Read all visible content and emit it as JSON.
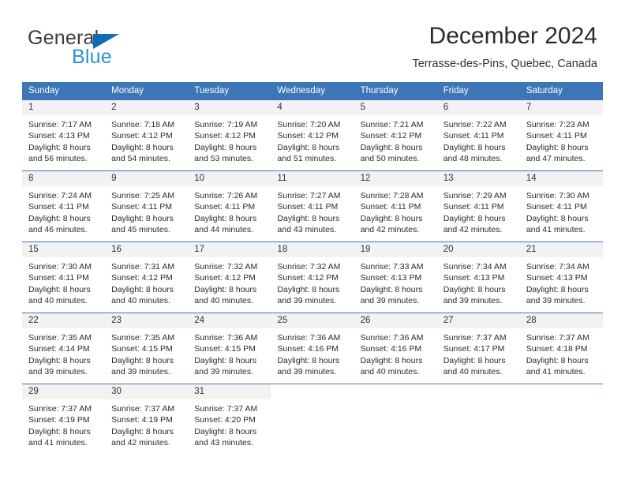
{
  "brand": {
    "name_part1": "General",
    "name_part2": "Blue",
    "triangle_icon": "triangle-icon",
    "colors": {
      "general_text": "#3c3c3c",
      "blue_text": "#2b8fd6",
      "triangle": "#0f6cb6"
    }
  },
  "header": {
    "title": "December 2024",
    "subtitle": "Terrasse-des-Pins, Quebec, Canada"
  },
  "calendar": {
    "accent_color": "#3b76b6",
    "daynum_band_color": "#f2f2f2",
    "weekday_headers": [
      "Sunday",
      "Monday",
      "Tuesday",
      "Wednesday",
      "Thursday",
      "Friday",
      "Saturday"
    ],
    "weeks": [
      [
        {
          "day": "1",
          "sunrise": "Sunrise: 7:17 AM",
          "sunset": "Sunset: 4:13 PM",
          "daylight1": "Daylight: 8 hours",
          "daylight2": "and 56 minutes."
        },
        {
          "day": "2",
          "sunrise": "Sunrise: 7:18 AM",
          "sunset": "Sunset: 4:12 PM",
          "daylight1": "Daylight: 8 hours",
          "daylight2": "and 54 minutes."
        },
        {
          "day": "3",
          "sunrise": "Sunrise: 7:19 AM",
          "sunset": "Sunset: 4:12 PM",
          "daylight1": "Daylight: 8 hours",
          "daylight2": "and 53 minutes."
        },
        {
          "day": "4",
          "sunrise": "Sunrise: 7:20 AM",
          "sunset": "Sunset: 4:12 PM",
          "daylight1": "Daylight: 8 hours",
          "daylight2": "and 51 minutes."
        },
        {
          "day": "5",
          "sunrise": "Sunrise: 7:21 AM",
          "sunset": "Sunset: 4:12 PM",
          "daylight1": "Daylight: 8 hours",
          "daylight2": "and 50 minutes."
        },
        {
          "day": "6",
          "sunrise": "Sunrise: 7:22 AM",
          "sunset": "Sunset: 4:11 PM",
          "daylight1": "Daylight: 8 hours",
          "daylight2": "and 48 minutes."
        },
        {
          "day": "7",
          "sunrise": "Sunrise: 7:23 AM",
          "sunset": "Sunset: 4:11 PM",
          "daylight1": "Daylight: 8 hours",
          "daylight2": "and 47 minutes."
        }
      ],
      [
        {
          "day": "8",
          "sunrise": "Sunrise: 7:24 AM",
          "sunset": "Sunset: 4:11 PM",
          "daylight1": "Daylight: 8 hours",
          "daylight2": "and 46 minutes."
        },
        {
          "day": "9",
          "sunrise": "Sunrise: 7:25 AM",
          "sunset": "Sunset: 4:11 PM",
          "daylight1": "Daylight: 8 hours",
          "daylight2": "and 45 minutes."
        },
        {
          "day": "10",
          "sunrise": "Sunrise: 7:26 AM",
          "sunset": "Sunset: 4:11 PM",
          "daylight1": "Daylight: 8 hours",
          "daylight2": "and 44 minutes."
        },
        {
          "day": "11",
          "sunrise": "Sunrise: 7:27 AM",
          "sunset": "Sunset: 4:11 PM",
          "daylight1": "Daylight: 8 hours",
          "daylight2": "and 43 minutes."
        },
        {
          "day": "12",
          "sunrise": "Sunrise: 7:28 AM",
          "sunset": "Sunset: 4:11 PM",
          "daylight1": "Daylight: 8 hours",
          "daylight2": "and 42 minutes."
        },
        {
          "day": "13",
          "sunrise": "Sunrise: 7:29 AM",
          "sunset": "Sunset: 4:11 PM",
          "daylight1": "Daylight: 8 hours",
          "daylight2": "and 42 minutes."
        },
        {
          "day": "14",
          "sunrise": "Sunrise: 7:30 AM",
          "sunset": "Sunset: 4:11 PM",
          "daylight1": "Daylight: 8 hours",
          "daylight2": "and 41 minutes."
        }
      ],
      [
        {
          "day": "15",
          "sunrise": "Sunrise: 7:30 AM",
          "sunset": "Sunset: 4:11 PM",
          "daylight1": "Daylight: 8 hours",
          "daylight2": "and 40 minutes."
        },
        {
          "day": "16",
          "sunrise": "Sunrise: 7:31 AM",
          "sunset": "Sunset: 4:12 PM",
          "daylight1": "Daylight: 8 hours",
          "daylight2": "and 40 minutes."
        },
        {
          "day": "17",
          "sunrise": "Sunrise: 7:32 AM",
          "sunset": "Sunset: 4:12 PM",
          "daylight1": "Daylight: 8 hours",
          "daylight2": "and 40 minutes."
        },
        {
          "day": "18",
          "sunrise": "Sunrise: 7:32 AM",
          "sunset": "Sunset: 4:12 PM",
          "daylight1": "Daylight: 8 hours",
          "daylight2": "and 39 minutes."
        },
        {
          "day": "19",
          "sunrise": "Sunrise: 7:33 AM",
          "sunset": "Sunset: 4:13 PM",
          "daylight1": "Daylight: 8 hours",
          "daylight2": "and 39 minutes."
        },
        {
          "day": "20",
          "sunrise": "Sunrise: 7:34 AM",
          "sunset": "Sunset: 4:13 PM",
          "daylight1": "Daylight: 8 hours",
          "daylight2": "and 39 minutes."
        },
        {
          "day": "21",
          "sunrise": "Sunrise: 7:34 AM",
          "sunset": "Sunset: 4:13 PM",
          "daylight1": "Daylight: 8 hours",
          "daylight2": "and 39 minutes."
        }
      ],
      [
        {
          "day": "22",
          "sunrise": "Sunrise: 7:35 AM",
          "sunset": "Sunset: 4:14 PM",
          "daylight1": "Daylight: 8 hours",
          "daylight2": "and 39 minutes."
        },
        {
          "day": "23",
          "sunrise": "Sunrise: 7:35 AM",
          "sunset": "Sunset: 4:15 PM",
          "daylight1": "Daylight: 8 hours",
          "daylight2": "and 39 minutes."
        },
        {
          "day": "24",
          "sunrise": "Sunrise: 7:36 AM",
          "sunset": "Sunset: 4:15 PM",
          "daylight1": "Daylight: 8 hours",
          "daylight2": "and 39 minutes."
        },
        {
          "day": "25",
          "sunrise": "Sunrise: 7:36 AM",
          "sunset": "Sunset: 4:16 PM",
          "daylight1": "Daylight: 8 hours",
          "daylight2": "and 39 minutes."
        },
        {
          "day": "26",
          "sunrise": "Sunrise: 7:36 AM",
          "sunset": "Sunset: 4:16 PM",
          "daylight1": "Daylight: 8 hours",
          "daylight2": "and 40 minutes."
        },
        {
          "day": "27",
          "sunrise": "Sunrise: 7:37 AM",
          "sunset": "Sunset: 4:17 PM",
          "daylight1": "Daylight: 8 hours",
          "daylight2": "and 40 minutes."
        },
        {
          "day": "28",
          "sunrise": "Sunrise: 7:37 AM",
          "sunset": "Sunset: 4:18 PM",
          "daylight1": "Daylight: 8 hours",
          "daylight2": "and 41 minutes."
        }
      ],
      [
        {
          "day": "29",
          "sunrise": "Sunrise: 7:37 AM",
          "sunset": "Sunset: 4:19 PM",
          "daylight1": "Daylight: 8 hours",
          "daylight2": "and 41 minutes."
        },
        {
          "day": "30",
          "sunrise": "Sunrise: 7:37 AM",
          "sunset": "Sunset: 4:19 PM",
          "daylight1": "Daylight: 8 hours",
          "daylight2": "and 42 minutes."
        },
        {
          "day": "31",
          "sunrise": "Sunrise: 7:37 AM",
          "sunset": "Sunset: 4:20 PM",
          "daylight1": "Daylight: 8 hours",
          "daylight2": "and 43 minutes."
        },
        {
          "day": "",
          "sunrise": "",
          "sunset": "",
          "daylight1": "",
          "daylight2": ""
        },
        {
          "day": "",
          "sunrise": "",
          "sunset": "",
          "daylight1": "",
          "daylight2": ""
        },
        {
          "day": "",
          "sunrise": "",
          "sunset": "",
          "daylight1": "",
          "daylight2": ""
        },
        {
          "day": "",
          "sunrise": "",
          "sunset": "",
          "daylight1": "",
          "daylight2": ""
        }
      ]
    ]
  }
}
